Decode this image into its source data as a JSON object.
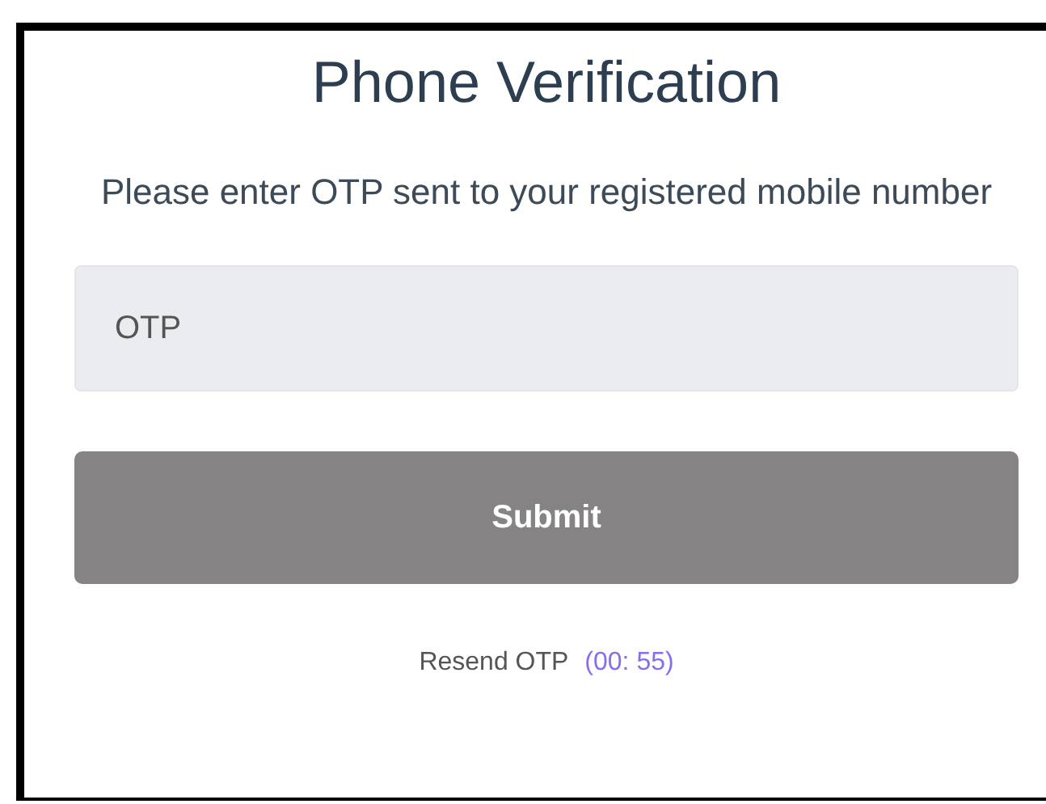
{
  "title": "Phone Verification",
  "instructions": "Please enter OTP sent to your registered mobile number",
  "otp_field": {
    "placeholder": "OTP"
  },
  "submit_button": {
    "label": "Submit",
    "disabled": true
  },
  "resend": {
    "label": "Resend OTP",
    "timer": "(00: 55)"
  }
}
